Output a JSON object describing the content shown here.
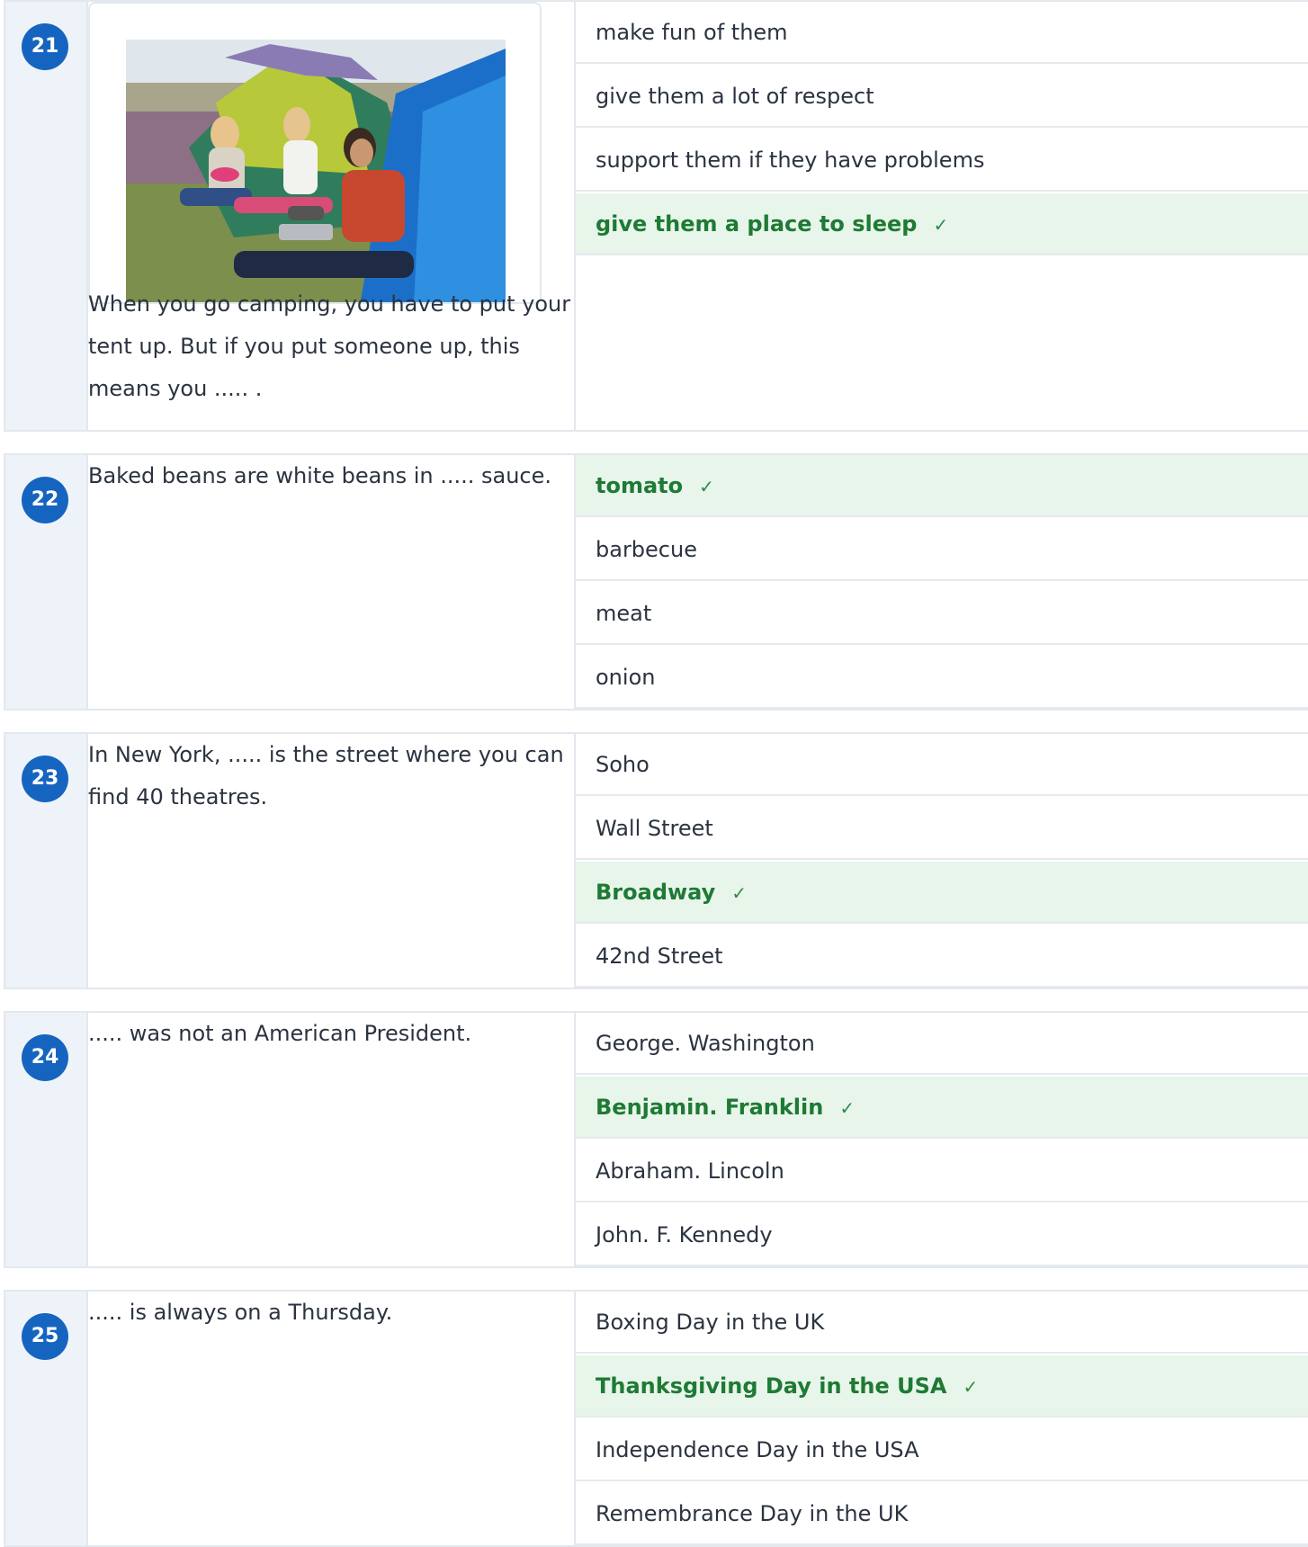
{
  "questions": [
    {
      "number": "21",
      "has_image": true,
      "image_alt": "Three girls camping outside colourful tents",
      "text": "When you go camping, you have to put your tent up. But if you put someone up, this means you ..... .",
      "options": [
        {
          "label": "make fun of them",
          "correct": false
        },
        {
          "label": "give them a lot of respect",
          "correct": false
        },
        {
          "label": "support them if they have problems",
          "correct": false
        },
        {
          "label": "give them a place to sleep",
          "correct": true
        }
      ]
    },
    {
      "number": "22",
      "has_image": false,
      "text": "Baked beans are white beans in ..... sauce.",
      "options": [
        {
          "label": "tomato",
          "correct": true
        },
        {
          "label": "barbecue",
          "correct": false
        },
        {
          "label": "meat",
          "correct": false
        },
        {
          "label": "onion",
          "correct": false
        }
      ]
    },
    {
      "number": "23",
      "has_image": false,
      "text": "In New York, ..... is the street where you can find 40 theatres.",
      "options": [
        {
          "label": "Soho",
          "correct": false
        },
        {
          "label": "Wall Street",
          "correct": false
        },
        {
          "label": "Broadway",
          "correct": true
        },
        {
          "label": "42nd Street",
          "correct": false
        }
      ]
    },
    {
      "number": "24",
      "has_image": false,
      "text": "..... was not an American President.",
      "options": [
        {
          "label": "George. Washington",
          "correct": false
        },
        {
          "label": "Benjamin. Franklin",
          "correct": true
        },
        {
          "label": "Abraham. Lincoln",
          "correct": false
        },
        {
          "label": "John. F. Kennedy",
          "correct": false
        }
      ]
    },
    {
      "number": "25",
      "has_image": false,
      "text": "..... is always on a Thursday.",
      "options": [
        {
          "label": "Boxing Day in the UK",
          "correct": false
        },
        {
          "label": "Thanksgiving Day in the USA",
          "correct": true
        },
        {
          "label": "Independence Day in the USA",
          "correct": false
        },
        {
          "label": "Remembrance Day in the UK",
          "correct": false
        }
      ]
    }
  ],
  "check_mark": "✓",
  "colors": {
    "badge": "#1565c0",
    "correct_bg": "#e8f5ea",
    "correct_text": "#1e7a34",
    "number_column_bg": "#eef3f9"
  },
  "icons": {
    "correct": "check-icon"
  }
}
